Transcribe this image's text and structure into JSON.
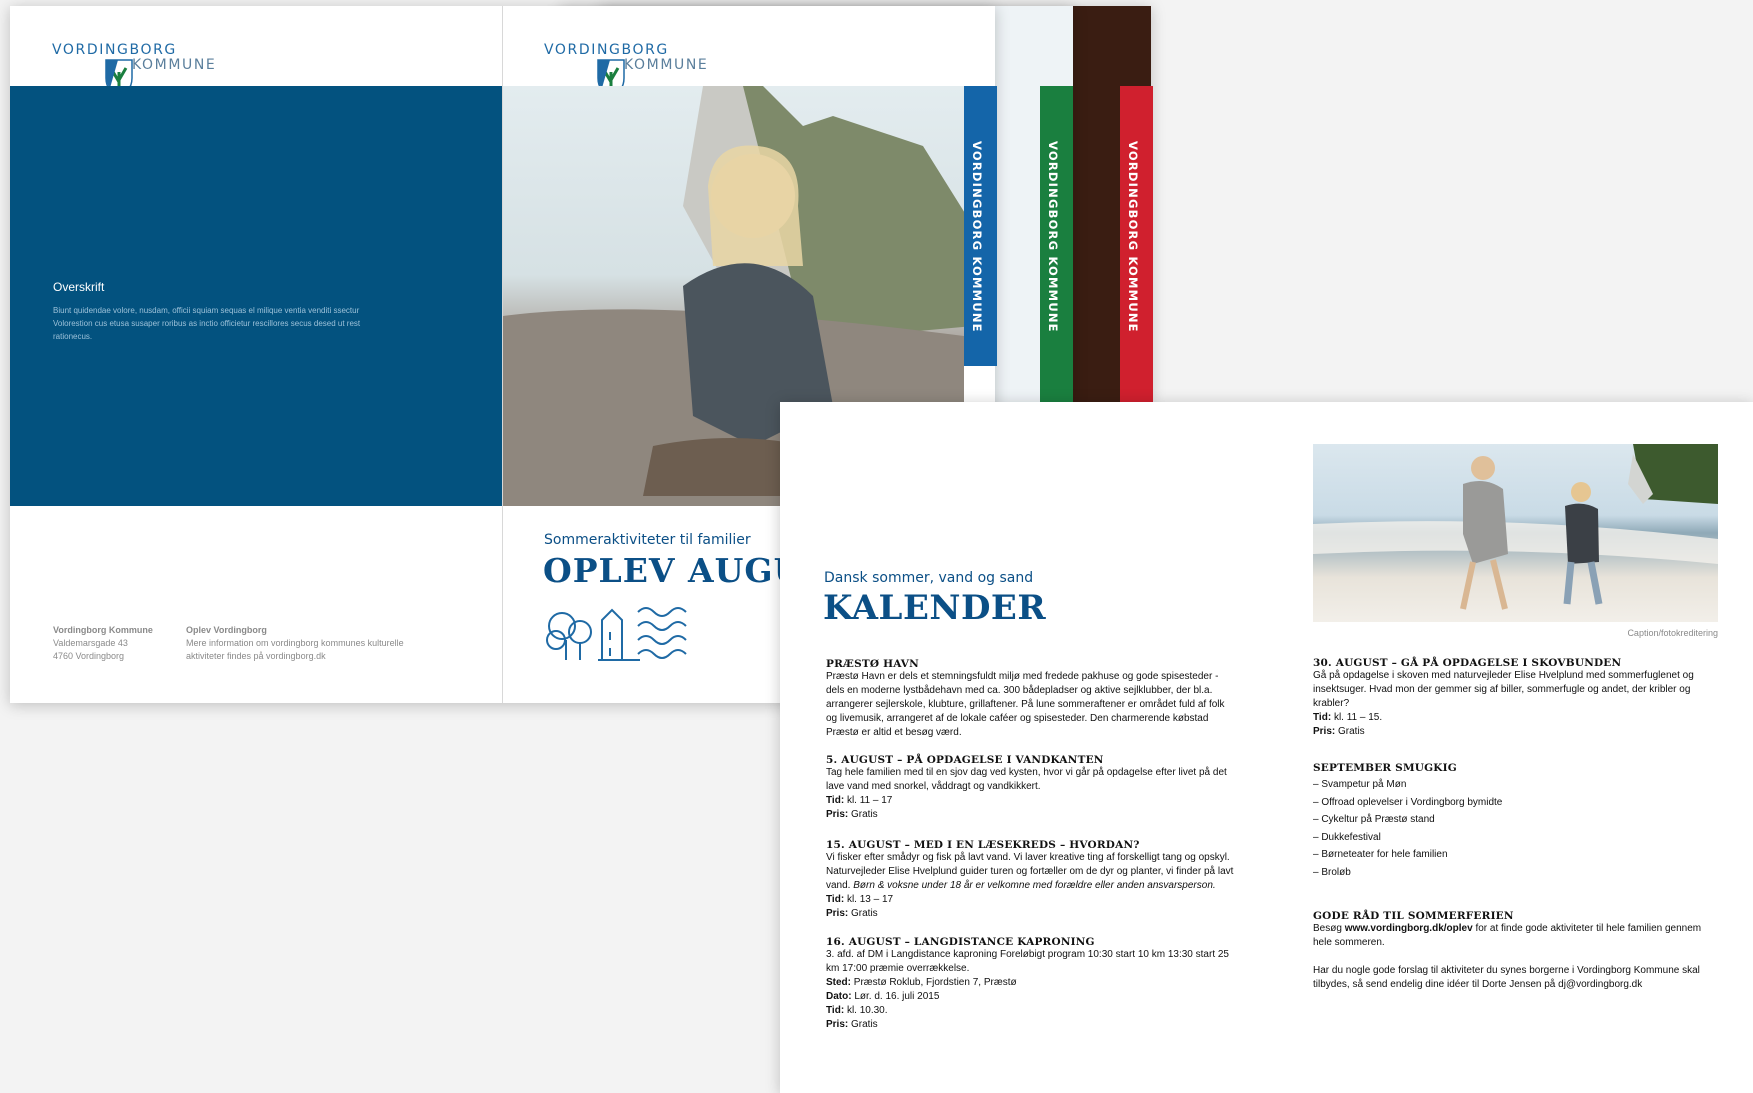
{
  "logo": {
    "line1": "VORDINGBORG",
    "line2": "KOMMUNE"
  },
  "back_cover": {
    "heading": "Overskrift",
    "body": "Biunt quidendae volore, nusdam, officii squiam sequas el milique ventia venditi ssectur Volorestion cus etusa susaper roribus as inctio officietur rescillores secus desed ut rest rationecus.",
    "footer": {
      "col1_title": "Vordingborg Kommune",
      "col1_line1": "Valdemarsgade 43",
      "col1_line2": "4760 Vordingborg",
      "col2_title": "Oplev Vordingborg",
      "col2_line1": "Mere information om vordingborg kommunes kulturelle",
      "col2_line2": "aktiviteter findes på vordingborg.dk"
    }
  },
  "front_cover": {
    "subtitle": "Sommeraktiviteter til familier",
    "title": "OPLEV AUGU"
  },
  "spines": [
    {
      "label": "VORDINGBORG KOMMUNE",
      "color": "#1465a9"
    },
    {
      "label": "VORDINGBORG KOMMUNE",
      "color": "#1a7f3f"
    },
    {
      "label": "VORDINGBORG KOMMUNE",
      "color": "#d0202e"
    }
  ],
  "calendar": {
    "subtitle": "Dansk sommer, vand og sand",
    "title": "KALENDER",
    "caption": "Caption/fotokreditering",
    "presto": {
      "heading": "PRÆSTØ HAVN",
      "body": "Præstø Havn er dels et stemningsfuldt miljø med fredede pakhuse og gode spisesteder - dels en moderne lystbådehavn med ca. 300 bådepladser og aktive sejlklubber, der bl.a. arrangerer sejlerskole, klubture, grillaftener. På lune sommeraftener er området fuld af folk og livemusik, arrangeret af de lokale caféer og spisesteder. Den charmerende købstad Præstø er altid et besøg værd."
    },
    "e1": {
      "heading": "5. AUGUST – PÅ OPDAGELSE I VANDKANTEN",
      "body": "Tag hele familien med til en sjov dag ved kysten, hvor vi går på opdagelse efter livet på det lave vand med snorkel, våddragt og vandkikkert.",
      "tid_label": "Tid:",
      "tid": "kl. 11 – 17",
      "pris_label": "Pris:",
      "pris": "Gratis"
    },
    "e2": {
      "heading": "15. AUGUST – MED I EN LÆSEKREDS – HVORDAN?",
      "body": "Vi fisker efter smådyr og fisk på lavt vand. Vi laver kreative ting af forskelligt tang og opskyl. Naturvejleder Elise Hvelplund guider turen og fortæller om de dyr og planter, vi finder på lavt vand.",
      "note": "Børn & voksne under 18 år er velkomne med forældre eller anden ansvarsperson.",
      "tid_label": "Tid:",
      "tid": "kl. 13 – 17",
      "pris_label": "Pris:",
      "pris": "Gratis"
    },
    "e3": {
      "heading": "16. AUGUST – LANGDISTANCE KAPRONING",
      "body": "3. afd. af DM i Langdistance kaproning Foreløbigt program 10:30 start 10 km 13:30 start 25 km 17:00 præmie overrækkelse.",
      "sted_label": "Sted:",
      "sted": "Præstø Roklub, Fjordstien 7, Præstø",
      "dato_label": "Dato:",
      "dato": "Lør. d. 16. juli 2015",
      "tid_label": "Tid:",
      "tid": "kl. 10.30.",
      "pris_label": "Pris:",
      "pris": "Gratis"
    },
    "e4": {
      "heading": "30. AUGUST – GÅ PÅ OPDAGELSE I SKOVBUNDEN",
      "body": "Gå på opdagelse i skoven med naturvejleder Elise Hvelplund med sommerfuglenet og insektsuger. Hvad mon der gemmer sig af biller, sommerfugle og andet, der kribler og krabler?",
      "tid_label": "Tid:",
      "tid": "kl. 11 – 15.",
      "pris_label": "Pris:",
      "pris": "Gratis"
    },
    "september": {
      "heading": "SEPTEMBER SMUGKIG",
      "items": [
        "– Svampetur på Møn",
        "– Offroad oplevelser i Vordingborg bymidte",
        "– Cykeltur på Præstø stand",
        "– Dukkefestival",
        "– Børneteater for hele familien",
        "– Broløb"
      ]
    },
    "tips": {
      "heading": "GODE RÅD TIL SOMMERFERIEN",
      "pre": "Besøg",
      "link": "www.vordingborg.dk/oplev",
      "post": "for at finde gode aktiviteter til hele familien gennem hele sommeren.",
      "body2": "Har du nogle gode forslag til aktiviteter du synes borgerne i Vordingborg Kommune skal tilbydes, så send endelig dine idéer til Dorte Jensen på dj@vordingborg.dk"
    }
  },
  "colors": {
    "brand_blue": "#03527f",
    "title_blue": "#0b4f86",
    "green": "#1a7f3f",
    "red": "#d0202e"
  }
}
